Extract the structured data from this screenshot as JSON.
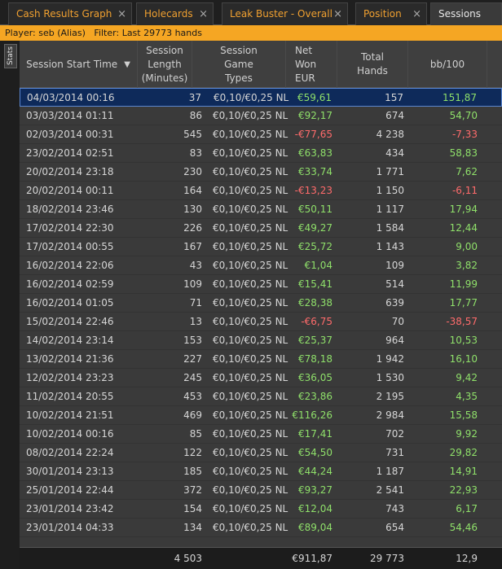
{
  "tabs": [
    {
      "label": "Cash Results Graph",
      "active": false
    },
    {
      "label": "Holecards",
      "active": false
    },
    {
      "label": "Leak Buster - Overall",
      "active": false
    },
    {
      "label": "Position",
      "active": false
    },
    {
      "label": "Sessions",
      "active": true
    }
  ],
  "tab_close_glyph": "×",
  "filter": {
    "player_label": "Player:",
    "player_value": "seb (Alias)",
    "filter_label": "Filter:",
    "filter_value": "Last 29773 hands"
  },
  "stats_button": "Stats",
  "columns": [
    "Session Start Time",
    "Session Length (Minutes)",
    "Session Game Types",
    "Net Won EUR",
    "Total Hands",
    "bb/100"
  ],
  "rows": [
    {
      "start": "04/03/2014 00:16",
      "length": "37",
      "game": "€0,10/€0,25 NL",
      "net": "€59,61",
      "hands": "157",
      "bb": "151,87",
      "sign": "pos"
    },
    {
      "start": "03/03/2014 01:11",
      "length": "86",
      "game": "€0,10/€0,25 NL",
      "net": "€92,17",
      "hands": "674",
      "bb": "54,70",
      "sign": "pos"
    },
    {
      "start": "02/03/2014 00:31",
      "length": "545",
      "game": "€0,10/€0,25 NL",
      "net": "-€77,65",
      "hands": "4 238",
      "bb": "-7,33",
      "sign": "neg"
    },
    {
      "start": "23/02/2014 02:51",
      "length": "83",
      "game": "€0,10/€0,25 NL",
      "net": "€63,83",
      "hands": "434",
      "bb": "58,83",
      "sign": "pos"
    },
    {
      "start": "20/02/2014 23:18",
      "length": "230",
      "game": "€0,10/€0,25 NL",
      "net": "€33,74",
      "hands": "1 771",
      "bb": "7,62",
      "sign": "pos"
    },
    {
      "start": "20/02/2014 00:11",
      "length": "164",
      "game": "€0,10/€0,25 NL",
      "net": "-€13,23",
      "hands": "1 150",
      "bb": "-6,11",
      "sign": "neg"
    },
    {
      "start": "18/02/2014 23:46",
      "length": "130",
      "game": "€0,10/€0,25 NL",
      "net": "€50,11",
      "hands": "1 117",
      "bb": "17,94",
      "sign": "pos"
    },
    {
      "start": "17/02/2014 22:30",
      "length": "226",
      "game": "€0,10/€0,25 NL",
      "net": "€49,27",
      "hands": "1 584",
      "bb": "12,44",
      "sign": "pos"
    },
    {
      "start": "17/02/2014 00:55",
      "length": "167",
      "game": "€0,10/€0,25 NL",
      "net": "€25,72",
      "hands": "1 143",
      "bb": "9,00",
      "sign": "pos"
    },
    {
      "start": "16/02/2014 22:06",
      "length": "43",
      "game": "€0,10/€0,25 NL",
      "net": "€1,04",
      "hands": "109",
      "bb": "3,82",
      "sign": "pos"
    },
    {
      "start": "16/02/2014 02:59",
      "length": "109",
      "game": "€0,10/€0,25 NL",
      "net": "€15,41",
      "hands": "514",
      "bb": "11,99",
      "sign": "pos"
    },
    {
      "start": "16/02/2014 01:05",
      "length": "71",
      "game": "€0,10/€0,25 NL",
      "net": "€28,38",
      "hands": "639",
      "bb": "17,77",
      "sign": "pos"
    },
    {
      "start": "15/02/2014 22:46",
      "length": "13",
      "game": "€0,10/€0,25 NL",
      "net": "-€6,75",
      "hands": "70",
      "bb": "-38,57",
      "sign": "neg"
    },
    {
      "start": "14/02/2014 23:14",
      "length": "153",
      "game": "€0,10/€0,25 NL",
      "net": "€25,37",
      "hands": "964",
      "bb": "10,53",
      "sign": "pos"
    },
    {
      "start": "13/02/2014 21:36",
      "length": "227",
      "game": "€0,10/€0,25 NL",
      "net": "€78,18",
      "hands": "1 942",
      "bb": "16,10",
      "sign": "pos"
    },
    {
      "start": "12/02/2014 23:23",
      "length": "245",
      "game": "€0,10/€0,25 NL",
      "net": "€36,05",
      "hands": "1 530",
      "bb": "9,42",
      "sign": "pos"
    },
    {
      "start": "11/02/2014 20:55",
      "length": "453",
      "game": "€0,10/€0,25 NL",
      "net": "€23,86",
      "hands": "2 195",
      "bb": "4,35",
      "sign": "pos"
    },
    {
      "start": "10/02/2014 21:51",
      "length": "469",
      "game": "€0,10/€0,25 NL",
      "net": "€116,26",
      "hands": "2 984",
      "bb": "15,58",
      "sign": "pos"
    },
    {
      "start": "10/02/2014 00:16",
      "length": "85",
      "game": "€0,10/€0,25 NL",
      "net": "€17,41",
      "hands": "702",
      "bb": "9,92",
      "sign": "pos"
    },
    {
      "start": "08/02/2014 22:24",
      "length": "122",
      "game": "€0,10/€0,25 NL",
      "net": "€54,50",
      "hands": "731",
      "bb": "29,82",
      "sign": "pos"
    },
    {
      "start": "30/01/2014 23:13",
      "length": "185",
      "game": "€0,10/€0,25 NL",
      "net": "€44,24",
      "hands": "1 187",
      "bb": "14,91",
      "sign": "pos"
    },
    {
      "start": "25/01/2014 22:44",
      "length": "372",
      "game": "€0,10/€0,25 NL",
      "net": "€93,27",
      "hands": "2 541",
      "bb": "22,93",
      "sign": "pos"
    },
    {
      "start": "23/01/2014 23:42",
      "length": "154",
      "game": "€0,10/€0,25 NL",
      "net": "€12,04",
      "hands": "743",
      "bb": "6,17",
      "sign": "pos"
    },
    {
      "start": "23/01/2014 04:33",
      "length": "134",
      "game": "€0,10/€0,25 NL",
      "net": "€89,04",
      "hands": "654",
      "bb": "54,46",
      "sign": "pos"
    }
  ],
  "totals": {
    "length": "4 503",
    "net": "€911,87",
    "hands": "29 773",
    "bb": "12,9"
  },
  "selected_row": 0,
  "colors": {
    "accent": "#f5a623",
    "positive": "#8fe06a",
    "negative": "#ff6b6b",
    "selected": "#0e2a5a"
  }
}
